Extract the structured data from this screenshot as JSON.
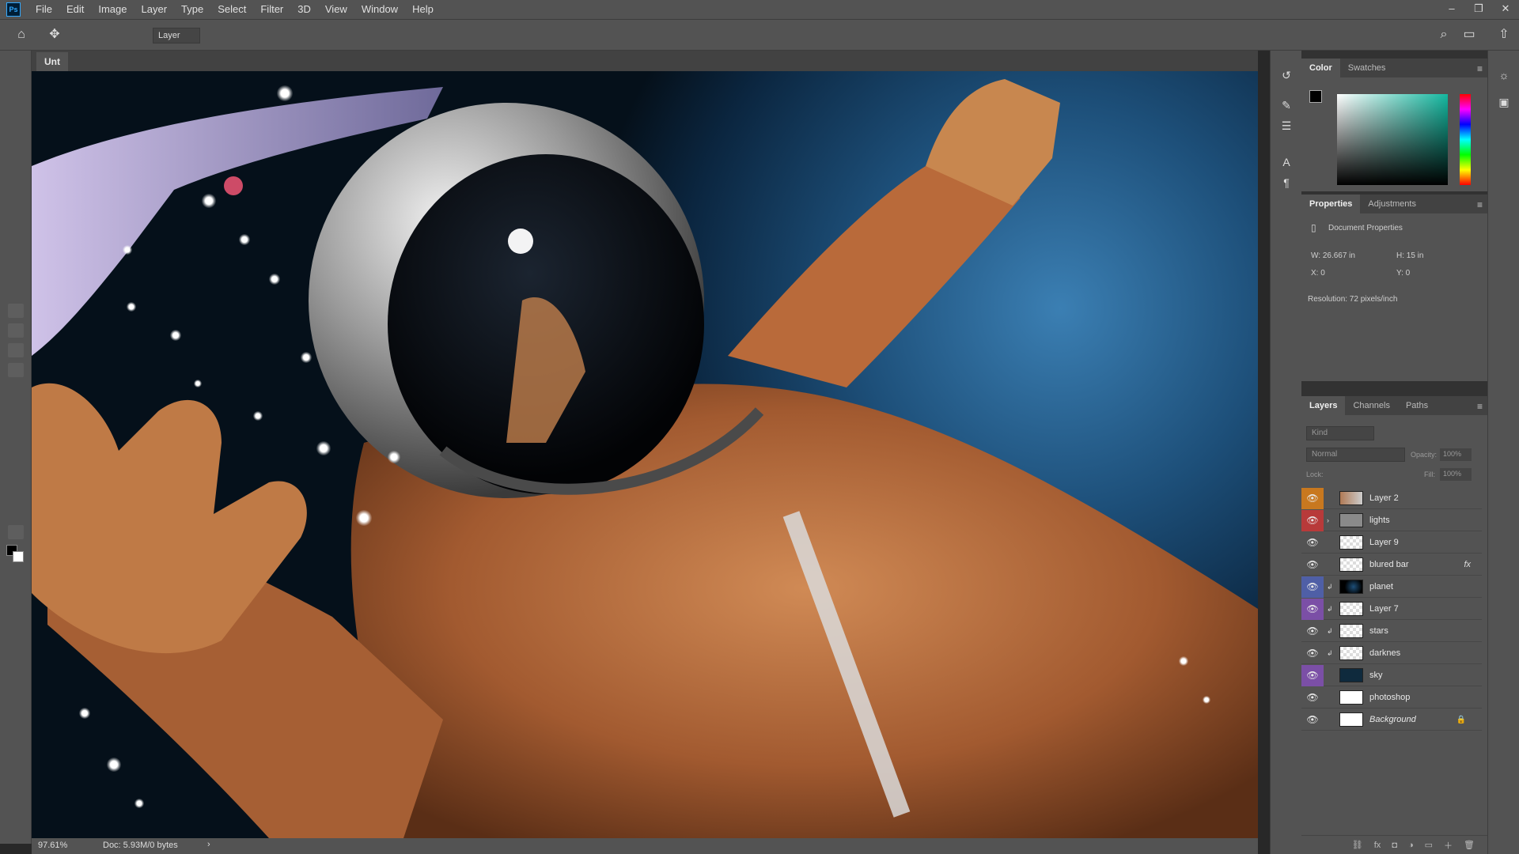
{
  "app": {
    "logo": "Ps"
  },
  "menu": [
    "File",
    "Edit",
    "Image",
    "Layer",
    "Type",
    "Select",
    "Filter",
    "3D",
    "View",
    "Window",
    "Help"
  ],
  "window_controls": {
    "minimize": "–",
    "restore": "❐",
    "close": "✕"
  },
  "options_bar": {
    "layer_select": "Layer"
  },
  "document": {
    "tab_label": "Unt"
  },
  "status": {
    "zoom": "97.61%",
    "doc_info": "Doc: 5.93M/0 bytes",
    "arrow": "›"
  },
  "color_panel": {
    "tabs": [
      "Color",
      "Swatches"
    ],
    "foreground": "#000000",
    "background": "#ffffff"
  },
  "properties_panel": {
    "tabs": [
      "Properties",
      "Adjustments"
    ],
    "section": "Document Properties",
    "w": "W:  26.667 in",
    "h": "H:  15 in",
    "x": "X:  0",
    "y": "Y:  0",
    "resolution": "Resolution: 72 pixels/inch"
  },
  "layers_panel": {
    "tabs": [
      "Layers",
      "Channels",
      "Paths"
    ],
    "kind_placeholder": "Kind",
    "blend_mode": "Normal",
    "opacity_label": "Opacity:",
    "opacity_value": "100%",
    "lock_label": "Lock:",
    "fill_label": "Fill:",
    "fill_value": "100%",
    "layers": [
      {
        "name": "Layer 2",
        "color": "#c8781f",
        "clipped": false,
        "fx": false
      },
      {
        "name": "lights",
        "color": "#b83a3a",
        "clipped": false,
        "fx": false,
        "group": true
      },
      {
        "name": "Layer 9",
        "color": "",
        "clipped": false,
        "fx": false
      },
      {
        "name": "blured bar",
        "color": "",
        "clipped": false,
        "fx": true
      },
      {
        "name": "planet",
        "color": "#4f5fa6",
        "clipped": true,
        "fx": false
      },
      {
        "name": "Layer 7",
        "color": "#7b4fa6",
        "clipped": true,
        "fx": false
      },
      {
        "name": "stars",
        "color": "",
        "clipped": true,
        "fx": false
      },
      {
        "name": "darknes",
        "color": "",
        "clipped": true,
        "fx": false
      },
      {
        "name": "sky",
        "color": "#7b4fa6",
        "clipped": false,
        "fx": false
      },
      {
        "name": "photoshop",
        "color": "",
        "clipped": false,
        "fx": false
      },
      {
        "name": "Background",
        "color": "",
        "clipped": false,
        "fx": false,
        "locked": true
      }
    ],
    "fx_symbol": "fx"
  },
  "icons": [
    "home-icon",
    "move-tool-icon",
    "search-icon",
    "workspace-icon",
    "share-icon",
    "eye-icon",
    "lock-icon",
    "folder-icon",
    "link-icon",
    "fx-icon",
    "mask-icon",
    "adjustment-icon",
    "new-group-icon",
    "new-layer-icon",
    "trash-icon",
    "learn-icon",
    "history-icon",
    "brush-icon",
    "adjust-icon",
    "type-icon",
    "paragraph-icon"
  ]
}
